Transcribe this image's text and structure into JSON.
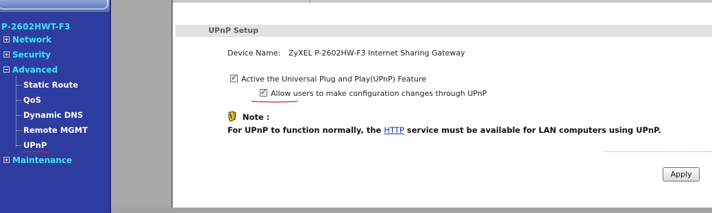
{
  "sidebar": {
    "device_title": "P-2602HWT-F3",
    "menu": {
      "network": "Network",
      "security": "Security",
      "advanced": "Advanced",
      "maintenance": "Maintenance"
    },
    "advanced_items": {
      "static_route": "Static Route",
      "qos": "QoS",
      "dynamic_dns": "Dynamic DNS",
      "remote_mgmt": "Remote MGMT",
      "upnp": "UPnP"
    }
  },
  "section": {
    "title": "UPnP Setup"
  },
  "device": {
    "label": "Device Name:",
    "value": "ZyXEL P-2602HW-F3 Internet Sharing Gateway"
  },
  "options": {
    "active_upnp": {
      "label": "Active the Universal Plug and Play(UPnP) Feature",
      "checked": true
    },
    "allow_config": {
      "label": "Allow users to make configuration changes through UPnP",
      "checked": true
    }
  },
  "note": {
    "label": "Note :",
    "text_before": "For UPnP to function normally, the ",
    "link": "HTTP",
    "text_after": " service must be available for LAN computers using UPnP."
  },
  "buttons": {
    "apply": "Apply"
  },
  "colors": {
    "sidebar_bg": "#2e3ca0",
    "menu_accent": "#38e4ff",
    "annotation_red": "#d42020"
  },
  "icons": {
    "note": "note-icon",
    "expand": "plus-box-icon",
    "collapse": "minus-box-icon",
    "checkbox": "checkbox-checked-icon"
  }
}
